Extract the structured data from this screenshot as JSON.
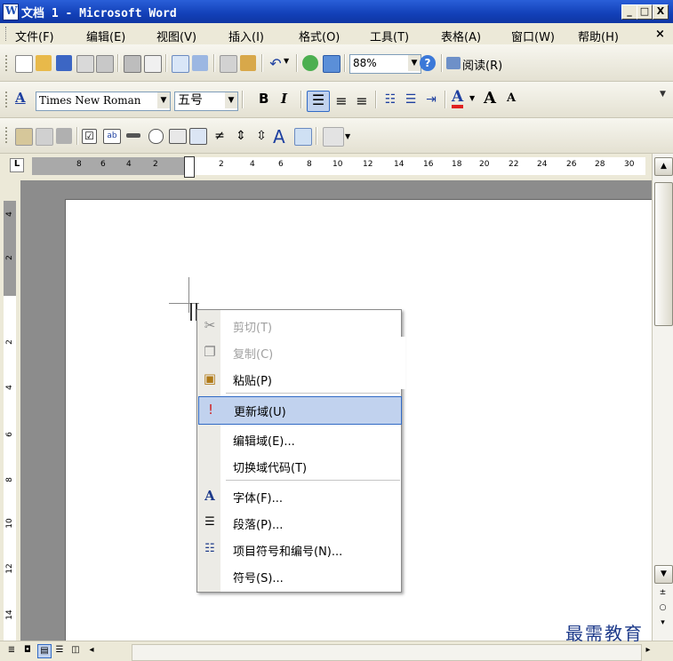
{
  "window": {
    "title": "文档 1 - Microsoft Word",
    "buttons": {
      "minimize": "_",
      "maximize": "□",
      "close": "X"
    }
  },
  "menubar": {
    "items": [
      "文件(F)",
      "编辑(E)",
      "视图(V)",
      "插入(I)",
      "格式(O)",
      "工具(T)",
      "表格(A)",
      "窗口(W)",
      "帮助(H)"
    ],
    "close_doc": "×"
  },
  "standard_toolbar": {
    "zoom": "88%",
    "read_label": "阅读(R)"
  },
  "format_toolbar": {
    "style_icon": "A",
    "font_name": "Times New Roman",
    "font_size": "五号",
    "bold": "B",
    "italic": "I",
    "font_color_letter": "A",
    "grow_font": "A",
    "shrink_font": "A"
  },
  "forms_toolbar": {
    "text_letter": "A"
  },
  "ruler": {
    "corner": "L",
    "left_numbers": [
      "8",
      "6",
      "4",
      "2"
    ],
    "right_numbers": [
      "2",
      "4",
      "6",
      "8",
      "10",
      "12",
      "14",
      "16",
      "18",
      "20",
      "22",
      "24",
      "26",
      "28",
      "30"
    ],
    "vertical_top_numbers": [
      "4",
      "2"
    ],
    "vertical_numbers": [
      "2",
      "4",
      "6",
      "8",
      "10",
      "12",
      "14"
    ]
  },
  "context_menu": {
    "items": [
      {
        "label": "剪切(T)",
        "icon": "scissors-icon",
        "enabled": false
      },
      {
        "label": "复制(C)",
        "icon": "copy-icon",
        "enabled": false
      },
      {
        "label": "粘贴(P)",
        "icon": "paste-icon",
        "enabled": true
      },
      {
        "label": "更新域(U)",
        "icon": "update-field-icon",
        "enabled": true,
        "highlighted": true
      },
      {
        "label": "编辑域(E)...",
        "icon": "",
        "enabled": true
      },
      {
        "label": "切换域代码(T)",
        "icon": "",
        "enabled": true
      },
      {
        "label": "字体(F)...",
        "icon": "font-icon",
        "enabled": true
      },
      {
        "label": "段落(P)...",
        "icon": "paragraph-icon",
        "enabled": true
      },
      {
        "label": "项目符号和编号(N)...",
        "icon": "bullets-icon",
        "enabled": true
      },
      {
        "label": "符号(S)...",
        "icon": "",
        "enabled": true
      }
    ]
  },
  "watermark": "最需教育",
  "colors": {
    "titlebar": "#1240b8",
    "menu_highlight": "#c1d2ee",
    "menu_highlight_border": "#316ac5",
    "workspace": "#8c8c8c"
  }
}
